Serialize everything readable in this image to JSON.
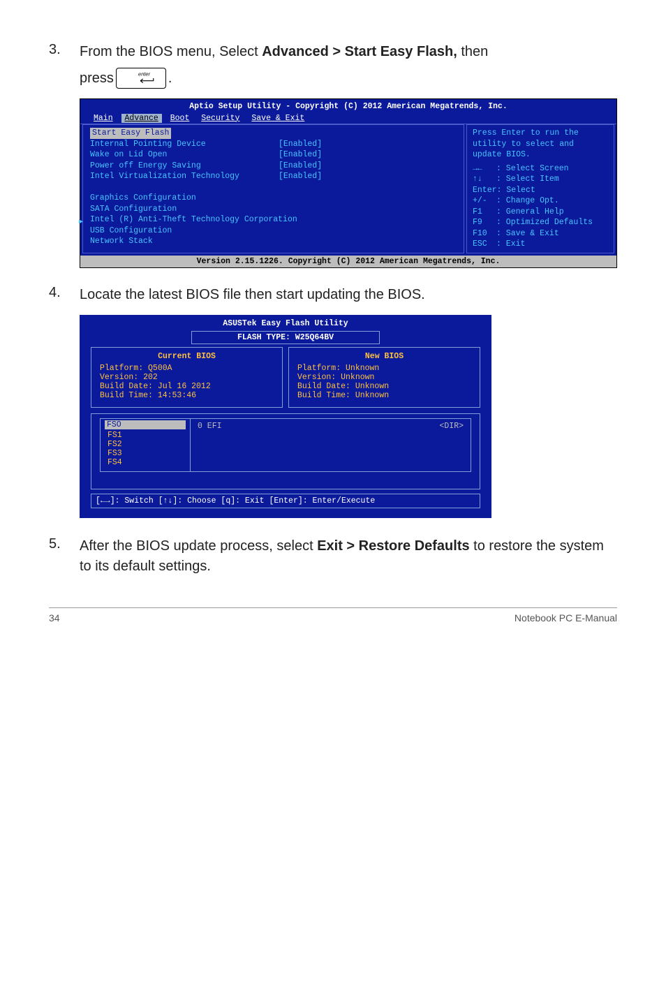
{
  "step3": {
    "num": "3.",
    "text_before_bold": "From the BIOS menu, Select ",
    "bold": "Advanced > Start Easy Flash,",
    "text_after_bold": " then",
    "press": "press ",
    "period": "."
  },
  "bios1": {
    "title": "Aptio Setup Utility - Copyright (C) 2012 American Megatrends, Inc.",
    "tabs": [
      "Main",
      "Advance",
      "Boot",
      "Security",
      "Save & Exit"
    ],
    "start_easy_flash": "Start Easy Flash",
    "rows": [
      {
        "lbl": "Internal Pointing Device",
        "val": "[Enabled]"
      },
      {
        "lbl": "Wake on Lid Open",
        "val": "[Enabled]"
      },
      {
        "lbl": "Power off Energy Saving",
        "val": "[Enabled]"
      },
      {
        "lbl": "Intel Virtualization Technology",
        "val": "[Enabled]"
      }
    ],
    "links": [
      "Graphics Configuration",
      "SATA Configuration",
      "Intel (R) Anti-Theft Technology Corporation",
      "USB Configuration",
      "Network Stack"
    ],
    "help": [
      "Press Enter to run the",
      "utility to select and",
      "update BIOS."
    ],
    "keys": [
      {
        "k": "→←",
        "t": ": Select Screen"
      },
      {
        "k": "↑↓",
        "t": ": Select Item"
      },
      {
        "k": "",
        "t": "Enter: Select"
      },
      {
        "k": "+/-",
        "t": ": Change Opt."
      },
      {
        "k": "F1",
        "t": ": General Help"
      },
      {
        "k": "F9",
        "t": ": Optimized Defaults"
      },
      {
        "k": "F10",
        "t": ": Save & Exit"
      },
      {
        "k": "ESC",
        "t": ": Exit"
      }
    ],
    "footer": "Version 2.15.1226. Copyright (C) 2012 American Megatrends, Inc."
  },
  "step4": {
    "num": "4.",
    "text": "Locate the latest BIOS file then start updating the BIOS."
  },
  "flash": {
    "title": "ASUSTek Easy Flash Utility",
    "type": "FLASH TYPE: W25Q64BV",
    "current_head": "Current BIOS",
    "current": [
      "Platform: Q500A",
      "Version: 202",
      "Build Date: Jul 16 2012",
      "Build Time: 14:53:46"
    ],
    "new_head": "New BIOS",
    "new": [
      "Platform: Unknown",
      "Version: Unknown",
      "Build Date: Unknown",
      "Build Time: Unknown"
    ],
    "fs_sel": "FSO",
    "fs": [
      "FS1",
      "FS2",
      "FS3",
      "FS4"
    ],
    "efi": "0 EFI",
    "dir": "<DIR>",
    "instr": "[←→]: Switch [↑↓]: Choose [q]: Exit [Enter]: Enter/Execute"
  },
  "step5": {
    "num": "5.",
    "text_before_bold": "After the BIOS update process, select ",
    "bold": "Exit > Restore Defaults",
    "text_after_bold": " to restore the system to its default settings."
  },
  "footer": {
    "page": "34",
    "label": "Notebook PC E-Manual"
  }
}
